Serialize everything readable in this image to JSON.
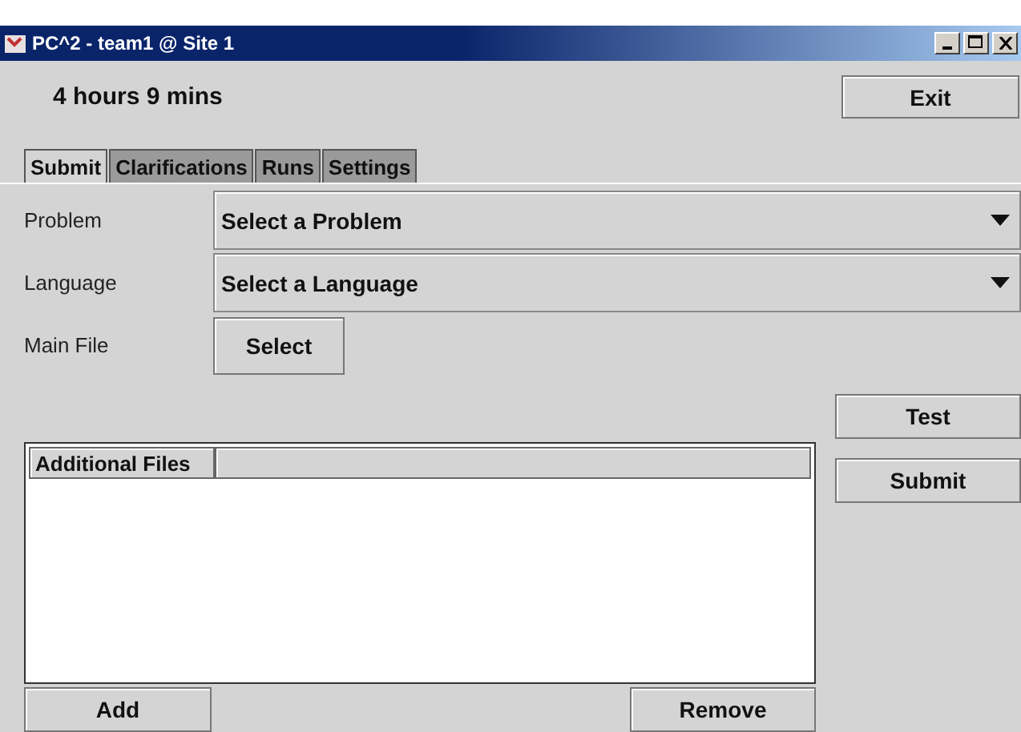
{
  "window": {
    "title": "PC^2 - team1 @ Site 1"
  },
  "timer": "4 hours 9 mins",
  "exit_button": "Exit",
  "tabs": [
    {
      "label": "Submit",
      "selected": true
    },
    {
      "label": "Clarifications",
      "selected": false
    },
    {
      "label": "Runs",
      "selected": false
    },
    {
      "label": "Settings",
      "selected": false
    }
  ],
  "form": {
    "problem": {
      "label": "Problem",
      "value": "Select a Problem"
    },
    "language": {
      "label": "Language",
      "value": "Select a Language"
    },
    "main_file": {
      "label": "Main File",
      "button": "Select"
    }
  },
  "actions": [
    "Test",
    "Submit"
  ],
  "table": {
    "columns": [
      "Additional Files"
    ]
  },
  "table_buttons": {
    "add": "Add",
    "remove": "Remove"
  }
}
